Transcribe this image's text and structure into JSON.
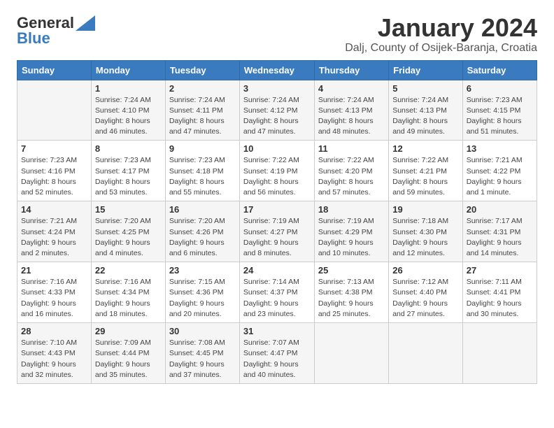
{
  "header": {
    "logo_general": "General",
    "logo_blue": "Blue",
    "title": "January 2024",
    "subtitle": "Dalj, County of Osijek-Baranja, Croatia"
  },
  "calendar": {
    "days_of_week": [
      "Sunday",
      "Monday",
      "Tuesday",
      "Wednesday",
      "Thursday",
      "Friday",
      "Saturday"
    ],
    "weeks": [
      [
        {
          "day": "",
          "info": ""
        },
        {
          "day": "1",
          "info": "Sunrise: 7:24 AM\nSunset: 4:10 PM\nDaylight: 8 hours\nand 46 minutes."
        },
        {
          "day": "2",
          "info": "Sunrise: 7:24 AM\nSunset: 4:11 PM\nDaylight: 8 hours\nand 47 minutes."
        },
        {
          "day": "3",
          "info": "Sunrise: 7:24 AM\nSunset: 4:12 PM\nDaylight: 8 hours\nand 47 minutes."
        },
        {
          "day": "4",
          "info": "Sunrise: 7:24 AM\nSunset: 4:13 PM\nDaylight: 8 hours\nand 48 minutes."
        },
        {
          "day": "5",
          "info": "Sunrise: 7:24 AM\nSunset: 4:13 PM\nDaylight: 8 hours\nand 49 minutes."
        },
        {
          "day": "6",
          "info": "Sunrise: 7:23 AM\nSunset: 4:15 PM\nDaylight: 8 hours\nand 51 minutes."
        }
      ],
      [
        {
          "day": "7",
          "info": "Sunrise: 7:23 AM\nSunset: 4:16 PM\nDaylight: 8 hours\nand 52 minutes."
        },
        {
          "day": "8",
          "info": "Sunrise: 7:23 AM\nSunset: 4:17 PM\nDaylight: 8 hours\nand 53 minutes."
        },
        {
          "day": "9",
          "info": "Sunrise: 7:23 AM\nSunset: 4:18 PM\nDaylight: 8 hours\nand 55 minutes."
        },
        {
          "day": "10",
          "info": "Sunrise: 7:22 AM\nSunset: 4:19 PM\nDaylight: 8 hours\nand 56 minutes."
        },
        {
          "day": "11",
          "info": "Sunrise: 7:22 AM\nSunset: 4:20 PM\nDaylight: 8 hours\nand 57 minutes."
        },
        {
          "day": "12",
          "info": "Sunrise: 7:22 AM\nSunset: 4:21 PM\nDaylight: 8 hours\nand 59 minutes."
        },
        {
          "day": "13",
          "info": "Sunrise: 7:21 AM\nSunset: 4:22 PM\nDaylight: 9 hours\nand 1 minute."
        }
      ],
      [
        {
          "day": "14",
          "info": "Sunrise: 7:21 AM\nSunset: 4:24 PM\nDaylight: 9 hours\nand 2 minutes."
        },
        {
          "day": "15",
          "info": "Sunrise: 7:20 AM\nSunset: 4:25 PM\nDaylight: 9 hours\nand 4 minutes."
        },
        {
          "day": "16",
          "info": "Sunrise: 7:20 AM\nSunset: 4:26 PM\nDaylight: 9 hours\nand 6 minutes."
        },
        {
          "day": "17",
          "info": "Sunrise: 7:19 AM\nSunset: 4:27 PM\nDaylight: 9 hours\nand 8 minutes."
        },
        {
          "day": "18",
          "info": "Sunrise: 7:19 AM\nSunset: 4:29 PM\nDaylight: 9 hours\nand 10 minutes."
        },
        {
          "day": "19",
          "info": "Sunrise: 7:18 AM\nSunset: 4:30 PM\nDaylight: 9 hours\nand 12 minutes."
        },
        {
          "day": "20",
          "info": "Sunrise: 7:17 AM\nSunset: 4:31 PM\nDaylight: 9 hours\nand 14 minutes."
        }
      ],
      [
        {
          "day": "21",
          "info": "Sunrise: 7:16 AM\nSunset: 4:33 PM\nDaylight: 9 hours\nand 16 minutes."
        },
        {
          "day": "22",
          "info": "Sunrise: 7:16 AM\nSunset: 4:34 PM\nDaylight: 9 hours\nand 18 minutes."
        },
        {
          "day": "23",
          "info": "Sunrise: 7:15 AM\nSunset: 4:36 PM\nDaylight: 9 hours\nand 20 minutes."
        },
        {
          "day": "24",
          "info": "Sunrise: 7:14 AM\nSunset: 4:37 PM\nDaylight: 9 hours\nand 23 minutes."
        },
        {
          "day": "25",
          "info": "Sunrise: 7:13 AM\nSunset: 4:38 PM\nDaylight: 9 hours\nand 25 minutes."
        },
        {
          "day": "26",
          "info": "Sunrise: 7:12 AM\nSunset: 4:40 PM\nDaylight: 9 hours\nand 27 minutes."
        },
        {
          "day": "27",
          "info": "Sunrise: 7:11 AM\nSunset: 4:41 PM\nDaylight: 9 hours\nand 30 minutes."
        }
      ],
      [
        {
          "day": "28",
          "info": "Sunrise: 7:10 AM\nSunset: 4:43 PM\nDaylight: 9 hours\nand 32 minutes."
        },
        {
          "day": "29",
          "info": "Sunrise: 7:09 AM\nSunset: 4:44 PM\nDaylight: 9 hours\nand 35 minutes."
        },
        {
          "day": "30",
          "info": "Sunrise: 7:08 AM\nSunset: 4:45 PM\nDaylight: 9 hours\nand 37 minutes."
        },
        {
          "day": "31",
          "info": "Sunrise: 7:07 AM\nSunset: 4:47 PM\nDaylight: 9 hours\nand 40 minutes."
        },
        {
          "day": "",
          "info": ""
        },
        {
          "day": "",
          "info": ""
        },
        {
          "day": "",
          "info": ""
        }
      ]
    ]
  }
}
